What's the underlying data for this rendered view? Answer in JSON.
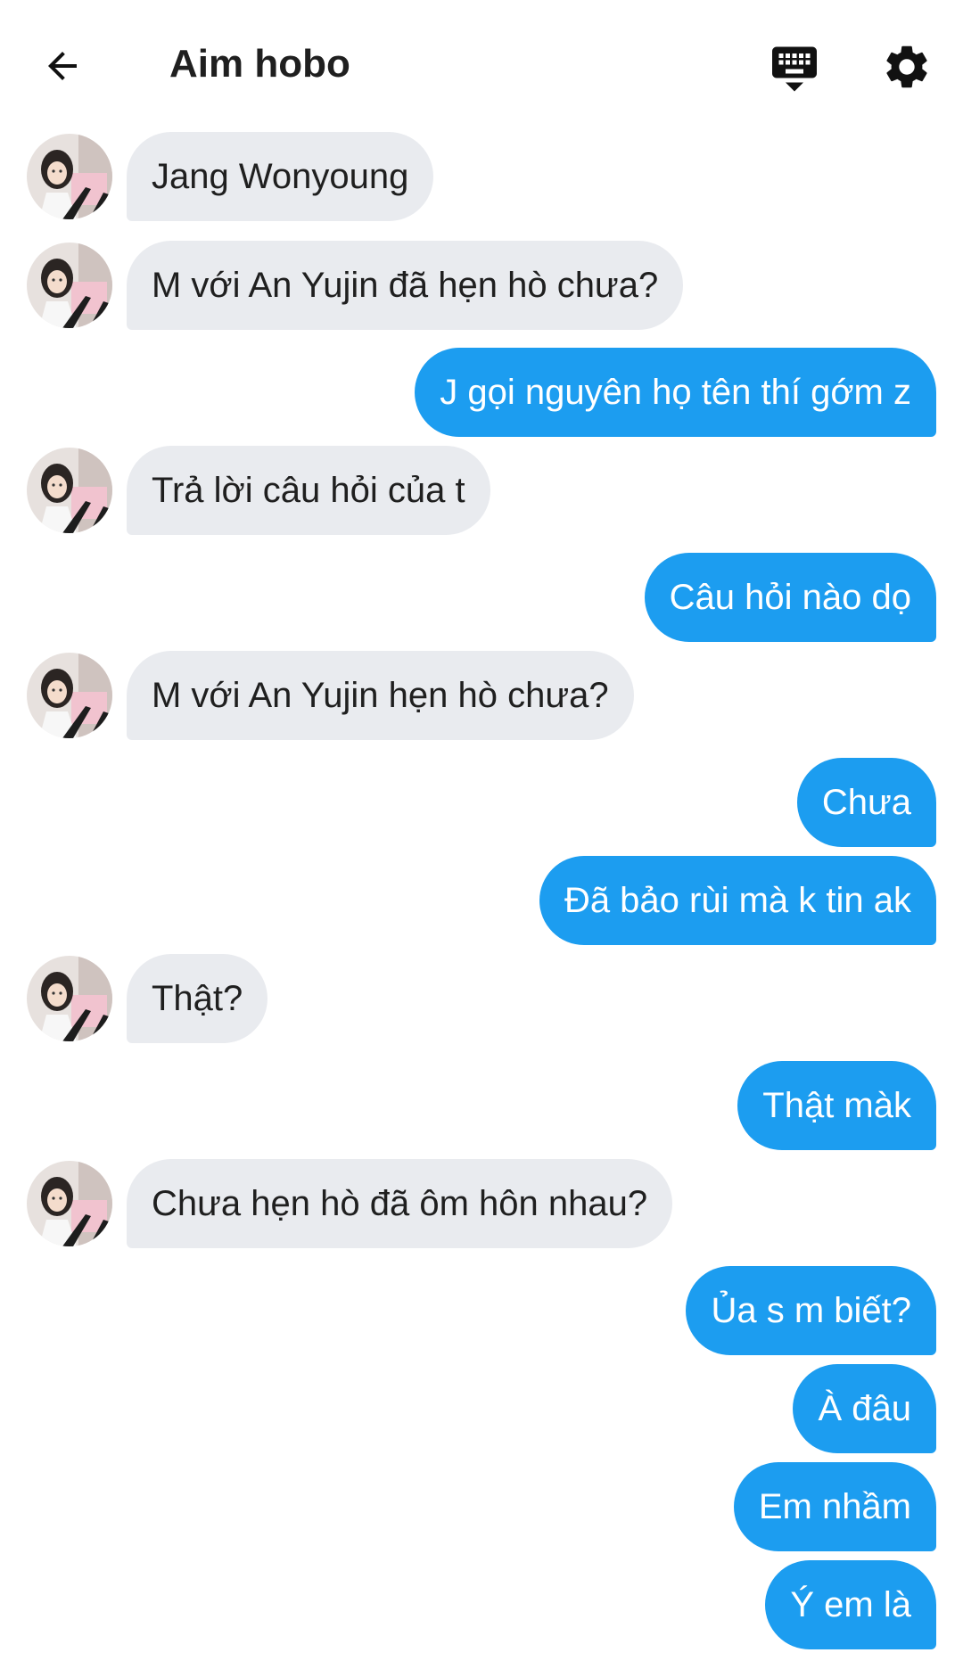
{
  "header": {
    "title": "Aim hobo",
    "back_icon": "arrow-left-icon",
    "keyboard_icon": "keyboard-icon",
    "settings_icon": "gear-icon"
  },
  "colors": {
    "outgoing_bubble": "#1c9df0",
    "incoming_bubble": "#e9ebef",
    "text_dark": "#1f1f1f",
    "text_light": "#ffffff"
  },
  "messages": [
    {
      "sender": "them",
      "text": "Jang Wonyoung"
    },
    {
      "sender": "them",
      "text": "M với An Yujin đã hẹn hò chưa?"
    },
    {
      "sender": "me",
      "text": "J gọi nguyên họ tên thí gớm z"
    },
    {
      "sender": "them",
      "text": "Trả lời câu hỏi của t"
    },
    {
      "sender": "me",
      "text": "Câu hỏi nào dọ"
    },
    {
      "sender": "them",
      "text": "M với An Yujin hẹn hò chưa?"
    },
    {
      "sender": "me",
      "text": "Chưa"
    },
    {
      "sender": "me",
      "text": "Đã bảo rùi mà k tin ak"
    },
    {
      "sender": "them",
      "text": "Thật?"
    },
    {
      "sender": "me",
      "text": "Thật màk"
    },
    {
      "sender": "them",
      "text": "Chưa hẹn hò đã ôm hôn nhau?"
    },
    {
      "sender": "me",
      "text": "Ủa s m biết?"
    },
    {
      "sender": "me",
      "text": "À đâu"
    },
    {
      "sender": "me",
      "text": "Em nhầm"
    },
    {
      "sender": "me",
      "text": "Ý em là"
    }
  ]
}
